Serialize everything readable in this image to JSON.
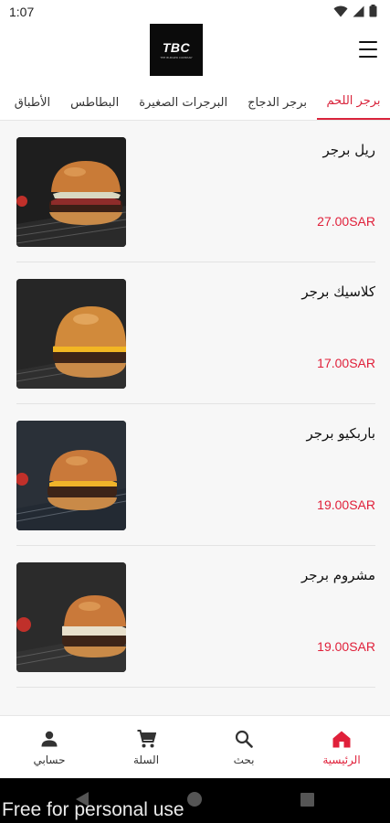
{
  "status_bar": {
    "time": "1:07"
  },
  "header": {
    "logo_text": "TBC",
    "logo_subtext": "THE BURGER COMPANY"
  },
  "tabs": [
    {
      "label": "برجر اللحم",
      "active": true
    },
    {
      "label": "برجر الدجاج",
      "active": false
    },
    {
      "label": "البرجرات الصغيرة",
      "active": false
    },
    {
      "label": "البطاطس",
      "active": false
    },
    {
      "label": "الأطباق",
      "active": false
    }
  ],
  "products": [
    {
      "name": "ريل برجر",
      "price": "27.00SAR"
    },
    {
      "name": "كلاسيك برجر",
      "price": "17.00SAR"
    },
    {
      "name": "باربكيو برجر",
      "price": "19.00SAR"
    },
    {
      "name": "مشروم برجر",
      "price": "19.00SAR"
    }
  ],
  "bottom_nav": [
    {
      "label": "الرئيسية",
      "icon": "home-icon",
      "active": true
    },
    {
      "label": "بحث",
      "icon": "search-icon",
      "active": false
    },
    {
      "label": "السلة",
      "icon": "cart-icon",
      "active": false
    },
    {
      "label": "حسابي",
      "icon": "person-icon",
      "active": false
    }
  ],
  "watermark": "Free for personal use",
  "colors": {
    "accent": "#e0203a",
    "logo_bg": "#0b0b0b"
  }
}
